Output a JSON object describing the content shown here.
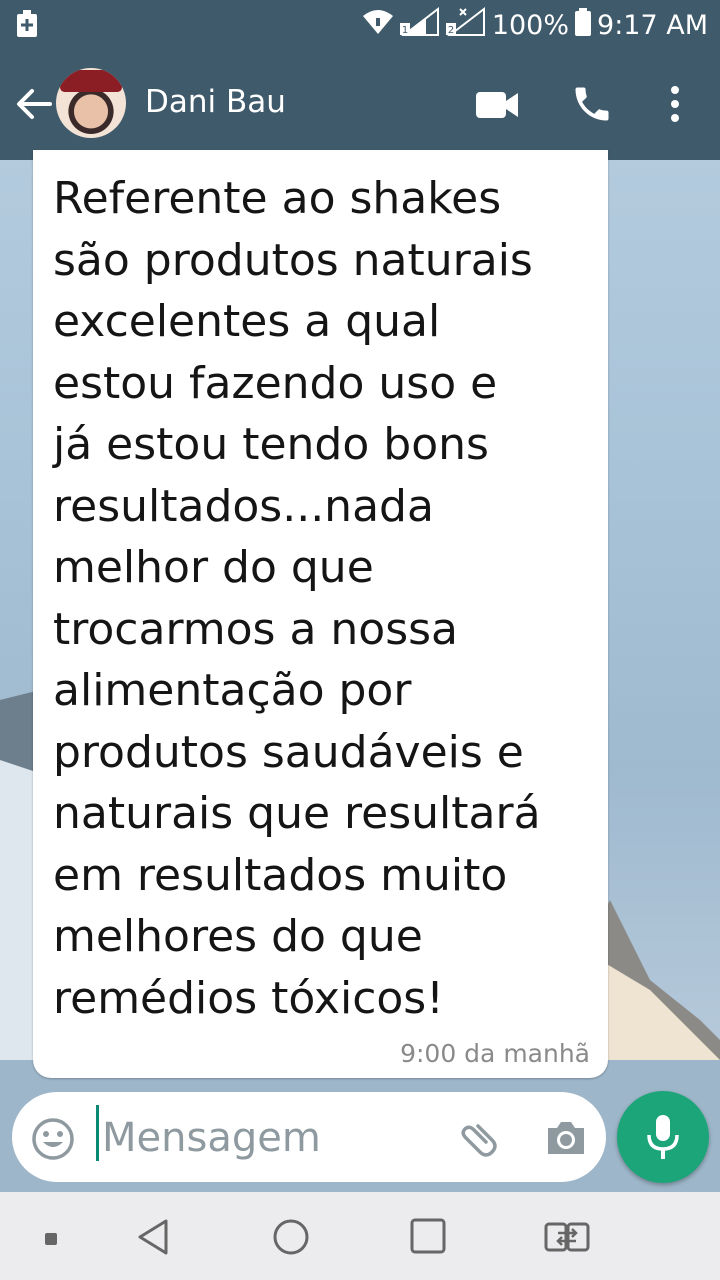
{
  "status_bar": {
    "battery": "100%",
    "time": "9:17 AM"
  },
  "header": {
    "contact_name": "Dani Bau"
  },
  "message": {
    "text_lines": [
      "Referente ao shakes",
      "são produtos naturais",
      "excelentes a qual",
      "estou fazendo uso e",
      "já estou tendo bons",
      "resultados...nada",
      "melhor do que",
      "trocarmos a nossa",
      "alimentação por",
      "produtos saudáveis e",
      "naturais que resultará",
      "em resultados muito",
      "melhores do que",
      "remédios tóxicos!"
    ],
    "timestamp": "9:00 da manhã"
  },
  "composer": {
    "placeholder": "Mensagem"
  },
  "colors": {
    "header_bg": "#3f5a6a",
    "mic_button": "#1da57a",
    "bubble_bg": "#ffffff"
  },
  "icons": {
    "back": "arrow-left-icon",
    "video": "video-camera-icon",
    "call": "phone-icon",
    "menu": "more-vertical-icon",
    "emoji": "emoji-icon",
    "attach": "paperclip-icon",
    "camera": "camera-icon",
    "mic": "microphone-icon"
  }
}
